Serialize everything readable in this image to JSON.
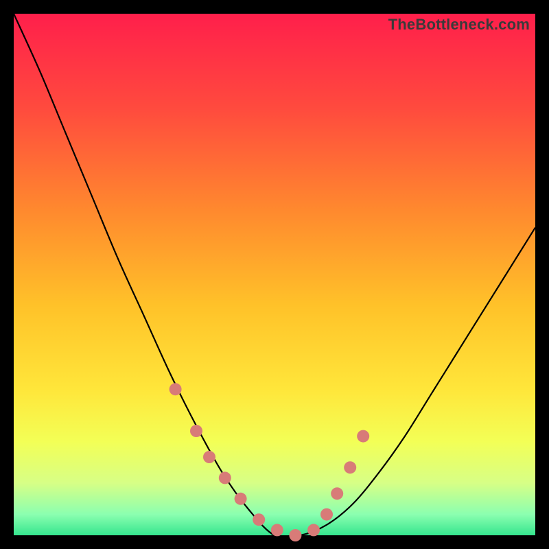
{
  "watermark": "TheBottleneck.com",
  "colors": {
    "black": "#000000",
    "curve_stroke": "#000000",
    "marker_fill": "#d87b78",
    "gradient_stops": [
      {
        "offset": 0.0,
        "color": "#ff1f4b"
      },
      {
        "offset": 0.18,
        "color": "#ff4a3e"
      },
      {
        "offset": 0.38,
        "color": "#ff8a2e"
      },
      {
        "offset": 0.56,
        "color": "#ffc229"
      },
      {
        "offset": 0.72,
        "color": "#ffe63a"
      },
      {
        "offset": 0.82,
        "color": "#f3ff56"
      },
      {
        "offset": 0.9,
        "color": "#d7ff86"
      },
      {
        "offset": 0.96,
        "color": "#8bffb0"
      },
      {
        "offset": 1.0,
        "color": "#35e58e"
      }
    ]
  },
  "chart_data": {
    "type": "line",
    "title": "",
    "xlabel": "",
    "ylabel": "",
    "categories": [],
    "x": [
      0.0,
      0.05,
      0.1,
      0.15,
      0.2,
      0.25,
      0.3,
      0.35,
      0.4,
      0.45,
      0.5,
      0.55,
      0.6,
      0.65,
      0.7,
      0.75,
      0.8,
      0.85,
      0.9,
      0.95,
      1.0
    ],
    "series": [
      {
        "name": "curve",
        "values": [
          100,
          89,
          77,
          65,
          53,
          42,
          31,
          21,
          12,
          5,
          0,
          0,
          2,
          6,
          12,
          19,
          27,
          35,
          43,
          51,
          59
        ]
      }
    ],
    "ylim": [
      0,
      100
    ],
    "xlim": [
      0,
      1
    ],
    "markers_x": [
      0.31,
      0.35,
      0.375,
      0.405,
      0.435,
      0.47,
      0.505,
      0.54,
      0.575,
      0.6,
      0.62,
      0.645,
      0.67
    ],
    "markers_y": [
      28,
      20,
      15,
      11,
      7,
      3,
      1,
      0,
      1,
      4,
      8,
      13,
      19
    ],
    "grid": false,
    "legend": false
  }
}
